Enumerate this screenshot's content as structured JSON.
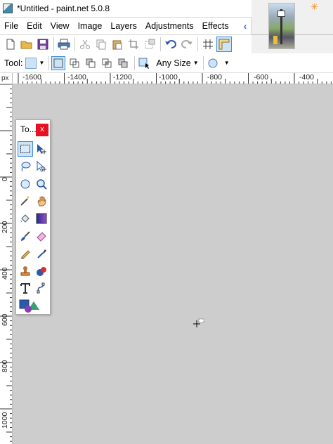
{
  "window": {
    "title": "*Untitled - paint.net 5.0.8"
  },
  "menu": {
    "items": [
      "File",
      "Edit",
      "View",
      "Image",
      "Layers",
      "Adjustments",
      "Effects"
    ],
    "overflow_icon": "chevron-left-icon"
  },
  "toolbar": {
    "buttons": [
      "new-icon",
      "open-icon",
      "save-icon",
      "print-icon",
      "cut-icon",
      "copy-icon",
      "paste-icon",
      "crop-icon",
      "deselect-icon",
      "undo-icon",
      "redo-icon",
      "grid-icon",
      "ruler-icon"
    ]
  },
  "tool_options": {
    "tool_label": "Tool:",
    "size_label": "Any Size"
  },
  "ruler": {
    "unit": "px",
    "h_labels": [
      "-1600",
      "-1400",
      "-1200",
      "-1000",
      "-800",
      "-600",
      "-400"
    ],
    "v_labels": [
      "0",
      "200",
      "400",
      "600",
      "800",
      "1000"
    ]
  },
  "tools_window": {
    "title": "To...",
    "close_label": "x",
    "tools": [
      "rectangle-select-icon",
      "move-selection-icon",
      "lasso-select-icon",
      "move-selected-icon",
      "ellipse-select-icon",
      "zoom-icon",
      "magic-wand-icon",
      "pan-icon",
      "paint-bucket-icon",
      "gradient-icon",
      "paintbrush-icon",
      "eraser-icon",
      "pencil-icon",
      "color-picker-icon",
      "clone-stamp-icon",
      "recolor-icon",
      "text-icon",
      "line-curve-icon",
      "shapes-icon"
    ]
  },
  "colors": {
    "accent": "#3d8ee0",
    "canvas": "#cdcdcd",
    "close": "#e81123",
    "selected_bg": "#cce4f7"
  }
}
